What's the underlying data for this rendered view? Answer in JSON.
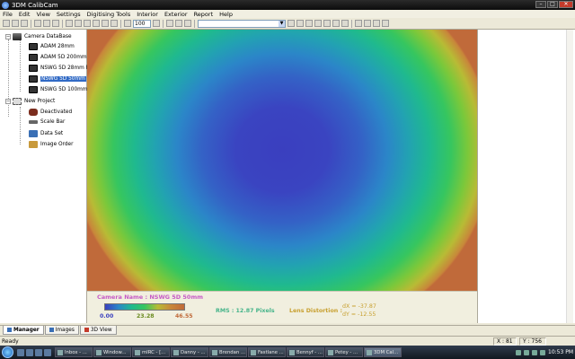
{
  "window": {
    "title": "3DM CalibCam"
  },
  "menu": [
    "File",
    "Edit",
    "View",
    "Settings",
    "Digitising Tools",
    "Interior",
    "Exterior",
    "Report",
    "Help"
  ],
  "toolbar": {
    "zoom_value": "100",
    "combo_value": ""
  },
  "tree": {
    "root": "Camera DataBase",
    "cameras": [
      "ADAM 28mm",
      "ADAM 5D 200mm",
      "NSWG 5D 28mm F",
      "NSWG 5D 50mm",
      "NSWG 5D 100mm"
    ],
    "selected_index": 3,
    "project": "New Project",
    "project_items": [
      "Deactivated",
      "Scale Bar",
      "Data Set",
      "Image Order"
    ]
  },
  "panel_tabs": [
    "Manager",
    "Images",
    "3D View"
  ],
  "info": {
    "camera_name": "Camera Name : NSWG 5D 50mm",
    "scale_min": "0.00",
    "scale_mid": "23.28",
    "scale_max": "46.55",
    "rms": "RMS : 12.87 Pixels",
    "lens_label": "Lens Distortion :",
    "dx": "dX = -37.87",
    "dy": "dY = -12.55"
  },
  "status": {
    "text": "Ready",
    "x": "X : 81",
    "y": "Y : 756"
  },
  "taskbar": {
    "tasks": [
      "Inbox - ...",
      "Window...",
      "mIRC - [...",
      "Danny - ...",
      "Brendan ...",
      "Fastlane ...",
      "Bennyf - ...",
      "Petey - ...",
      "3DM Cal..."
    ],
    "active_index": 8,
    "clock": "10:53 PM"
  },
  "colors": {
    "accent": "#316ac5",
    "camname": "#c65ac6",
    "rms": "#46b48a",
    "lens": "#c8a030"
  }
}
